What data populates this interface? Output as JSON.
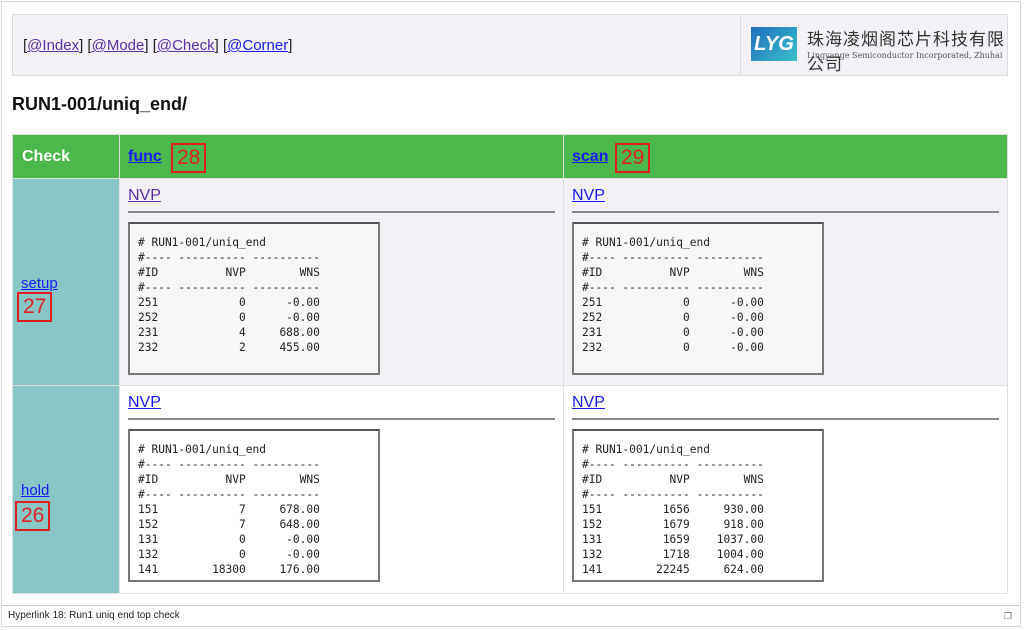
{
  "nav": {
    "links": [
      "@Index",
      "@Mode",
      "@Check",
      "@Corner"
    ],
    "logo_mark": "LYG",
    "logo_cn": "珠海凌烟阁芯片科技有限公司",
    "logo_en": "Lingyange Semiconductor Incorporated, Zhuhai"
  },
  "title": "RUN1-001/uniq_end/",
  "table": {
    "header": {
      "check": "Check",
      "col1": "func",
      "col2": "scan"
    },
    "rows": [
      {
        "label": "setup",
        "cells": [
          {
            "link": "NVP",
            "report": "# RUN1-001/uniq_end\n#---- ---------- ----------\n#ID          NVP        WNS\n#---- ---------- ----------\n251            0      -0.00\n252            0      -0.00\n231            4     688.00\n232            2     455.00"
          },
          {
            "link": "NVP",
            "report": "# RUN1-001/uniq_end\n#---- ---------- ----------\n#ID          NVP        WNS\n#---- ---------- ----------\n251            0      -0.00\n252            0      -0.00\n231            0      -0.00\n232            0      -0.00"
          }
        ]
      },
      {
        "label": "hold",
        "cells": [
          {
            "link": "NVP",
            "report": "# RUN1-001/uniq_end\n#---- ---------- ----------\n#ID          NVP        WNS\n#---- ---------- ----------\n151            7     678.00\n152            7     648.00\n131            0      -0.00\n132            0      -0.00\n141        18300     176.00"
          },
          {
            "link": "NVP",
            "report": "# RUN1-001/uniq_end\n#---- ---------- ----------\n#ID          NVP        WNS\n#---- ---------- ----------\n151         1656     930.00\n152         1679     918.00\n131         1659    1037.00\n132         1718    1004.00\n141        22245     624.00"
          }
        ]
      }
    ]
  },
  "annotations": {
    "func": "28",
    "scan": "29",
    "setup": "27",
    "hold": "26"
  },
  "status_bar": "Hyperlink 18: Run1 uniq end top check",
  "colors": {
    "header_green": "#4cb84c",
    "side_teal": "#88c6c8",
    "link_blue": "#1a1aee",
    "visited_purple": "#5b2fa6",
    "annotation_red": "#e02020"
  }
}
